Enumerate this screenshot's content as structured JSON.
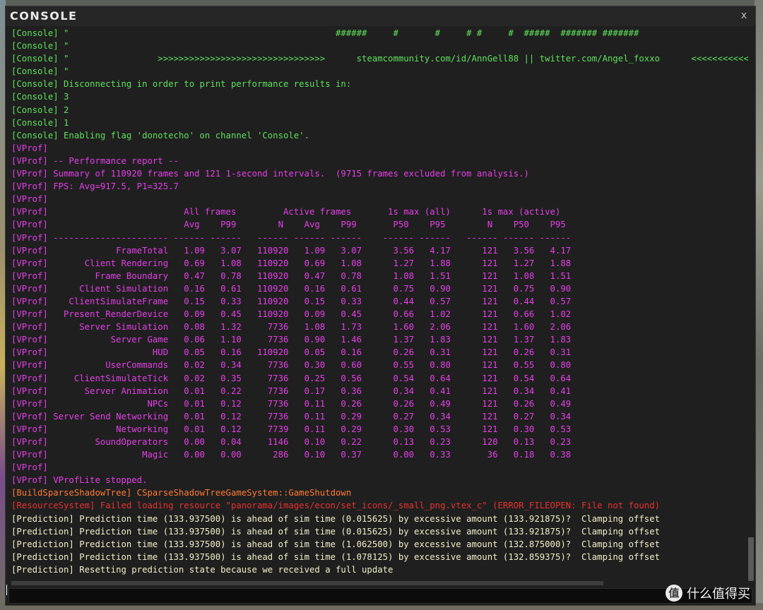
{
  "window": {
    "title": "CONSOLE",
    "close_label": "x"
  },
  "colors": {
    "console": "#5fe05c",
    "vprof": "#e53fe8",
    "shadow": "#ff7a35",
    "error": "#e8322e",
    "prediction": "#f0f0c8"
  },
  "log": [
    {
      "type": "console",
      "text": "[Console] \"                                                   ######     #       #     # #     #  #####  ####### #######"
    },
    {
      "type": "console",
      "text": "[Console] \""
    },
    {
      "type": "console",
      "text": "[Console] \"                 >>>>>>>>>>>>>>>>>>>>>>>>>>>>>>>>      steamcommunity.com/id/AnnGell88 || twitter.com/Angel_foxxo      <<<<<<<<<<<<"
    },
    {
      "type": "console",
      "text": "[Console] \""
    },
    {
      "type": "console",
      "text": "[Console] Disconnecting in order to print performance results in:"
    },
    {
      "type": "console",
      "text": "[Console] 3"
    },
    {
      "type": "console",
      "text": "[Console] 2"
    },
    {
      "type": "console",
      "text": "[Console] 1"
    },
    {
      "type": "console",
      "text": "[Console] Enabling flag 'donotecho' on channel 'Console'."
    },
    {
      "type": "vprof",
      "text": "[VProf]"
    },
    {
      "type": "vprof",
      "text": "[VProf] -- Performance report --"
    },
    {
      "type": "vprof",
      "text": "[VProf] Summary of 110920 frames and 121 1-second intervals.  (9715 frames excluded from analysis.)"
    },
    {
      "type": "vprof",
      "text": "[VProf] FPS: Avg=917.5, P1=325.7"
    },
    {
      "type": "vprof",
      "text": "[VProf]"
    },
    {
      "type": "vprof",
      "text": "[VProf]                          All frames         Active frames       1s max (all)      1s max (active)"
    },
    {
      "type": "vprof",
      "text": "[VProf]                          Avg    P99        N    Avg    P99       P50    P95        N    P50    P95"
    },
    {
      "type": "vprof",
      "text": "[VProf] ---------------------- ------ ------   ------ ------ ------    ------ ------   ------ ------ ------"
    },
    {
      "type": "vprof",
      "text": "[VProf]             FrameTotal   1.09   3.07   110920   1.09   3.07      3.56   4.17      121   3.56   4.17"
    },
    {
      "type": "vprof",
      "text": "[VProf]       Client Rendering   0.69   1.08   110920   0.69   1.08      1.27   1.88      121   1.27   1.88"
    },
    {
      "type": "vprof",
      "text": "[VProf]         Frame Boundary   0.47   0.78   110920   0.47   0.78      1.08   1.51      121   1.08   1.51"
    },
    {
      "type": "vprof",
      "text": "[VProf]      Client Simulation   0.16   0.61   110920   0.16   0.61      0.75   0.90      121   0.75   0.90"
    },
    {
      "type": "vprof",
      "text": "[VProf]    ClientSimulateFrame   0.15   0.33   110920   0.15   0.33      0.44   0.57      121   0.44   0.57"
    },
    {
      "type": "vprof",
      "text": "[VProf]   Present_RenderDevice   0.09   0.45   110920   0.09   0.45      0.66   1.02      121   0.66   1.02"
    },
    {
      "type": "vprof",
      "text": "[VProf]      Server Simulation   0.08   1.32     7736   1.08   1.73      1.60   2.06      121   1.60   2.06"
    },
    {
      "type": "vprof",
      "text": "[VProf]            Server Game   0.06   1.10     7736   0.90   1.46      1.37   1.83      121   1.37   1.83"
    },
    {
      "type": "vprof",
      "text": "[VProf]                    HUD   0.05   0.16   110920   0.05   0.16      0.26   0.31      121   0.26   0.31"
    },
    {
      "type": "vprof",
      "text": "[VProf]           UserCommands   0.02   0.34     7736   0.30   0.60      0.55   0.80      121   0.55   0.80"
    },
    {
      "type": "vprof",
      "text": "[VProf]     ClientSimulateTick   0.02   0.35     7736   0.25   0.56      0.54   0.64      121   0.54   0.64"
    },
    {
      "type": "vprof",
      "text": "[VProf]       Server Animation   0.01   0.22     7736   0.17   0.36      0.34   0.41      121   0.34   0.41"
    },
    {
      "type": "vprof",
      "text": "[VProf]                   NPCs   0.01   0.12     7736   0.11   0.26      0.26   0.49      121   0.26   0.49"
    },
    {
      "type": "vprof",
      "text": "[VProf] Server Send Networking   0.01   0.12     7736   0.11   0.29      0.27   0.34      121   0.27   0.34"
    },
    {
      "type": "vprof",
      "text": "[VProf]             Networking   0.01   0.12     7739   0.11   0.29      0.30   0.53      121   0.30   0.53"
    },
    {
      "type": "vprof",
      "text": "[VProf]         SoundOperators   0.00   0.04     1146   0.10   0.22      0.13   0.23      120   0.13   0.23"
    },
    {
      "type": "vprof",
      "text": "[VProf]                  Magic   0.00   0.00      286   0.10   0.37      0.00   0.33       36   0.18   0.38"
    },
    {
      "type": "vprof",
      "text": "[VProf]"
    },
    {
      "type": "vprof",
      "text": "[VProf] VProfLite stopped."
    },
    {
      "type": "shadow",
      "text": "[BuildSparseShadowTree] CSparseShadowTreeGameSystem::GameShutdown"
    },
    {
      "type": "error",
      "text": "[ResourceSystem] Failed loading resource \"panorama/images/econ/set_icons/_small_png.vtex_c\" (ERROR_FILEOPEN: File not found)"
    },
    {
      "type": "pred",
      "text": "[Prediction] Prediction time (133.937500) is ahead of sim time (0.015625) by excessive amount (133.921875)?  Clamping offset"
    },
    {
      "type": "pred",
      "text": "[Prediction] Prediction time (133.937500) is ahead of sim time (0.015625) by excessive amount (133.921875)?  Clamping offset"
    },
    {
      "type": "pred",
      "text": "[Prediction] Prediction time (133.937500) is ahead of sim time (1.062500) by excessive amount (132.875000)?  Clamping offset"
    },
    {
      "type": "pred",
      "text": "[Prediction] Prediction time (133.937500) is ahead of sim time (1.078125) by excessive amount (132.859375)?  Clamping offset"
    },
    {
      "type": "pred",
      "text": "[Prediction] Resetting prediction state because we received a full update"
    }
  ],
  "input": {
    "value": "",
    "placeholder": ""
  },
  "watermark": {
    "badge": "值",
    "text": "什么值得买"
  }
}
